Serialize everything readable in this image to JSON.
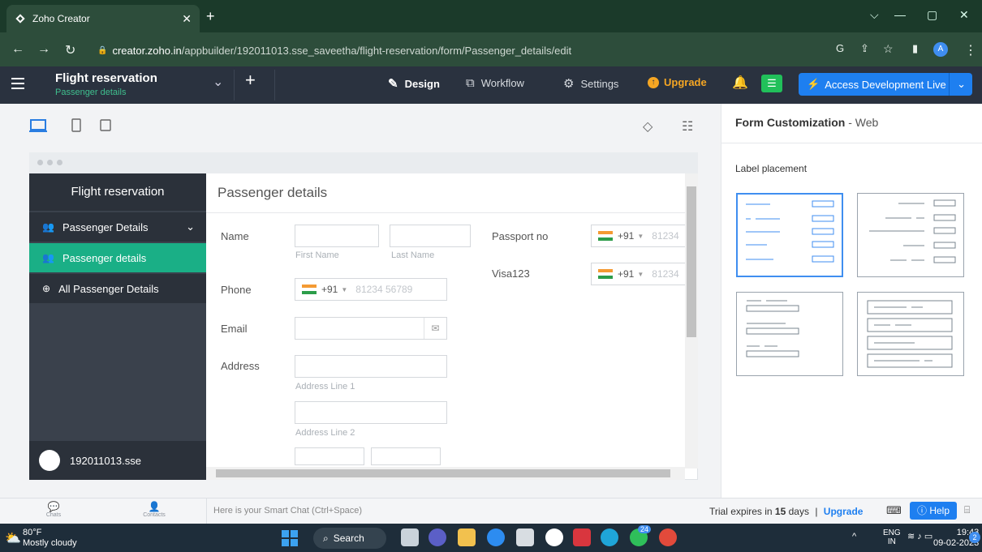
{
  "browser": {
    "tab_title": "Zoho Creator",
    "url_host": "creator.zoho.in",
    "url_path": "/appbuilder/192011013.sse_saveetha/flight-reservation/form/Passenger_details/edit"
  },
  "header": {
    "app_name": "Flight reservation",
    "form_name": "Passenger details",
    "tabs": [
      {
        "label": "Design",
        "icon": "palette-icon"
      },
      {
        "label": "Workflow",
        "icon": "workflow-icon"
      },
      {
        "label": "Settings",
        "icon": "gear-icon"
      }
    ],
    "upgrade_label": "Upgrade",
    "access_label": "Access Development Live"
  },
  "sidebar": {
    "title": "Flight reservation",
    "items": [
      {
        "label": "Passenger Details"
      },
      {
        "label": "Passenger details"
      },
      {
        "label": "All Passenger Details"
      }
    ],
    "user": "192011013.sse"
  },
  "form": {
    "title": "Passenger details",
    "name_label": "Name",
    "first_name_sub": "First Name",
    "last_name_sub": "Last Name",
    "phone_label": "Phone",
    "email_label": "Email",
    "address_label": "Address",
    "address_line1_sub": "Address Line 1",
    "address_line2_sub": "Address Line 2",
    "passport_label": "Passport no",
    "visa_label": "Visa123",
    "country_code": "+91",
    "phone_placeholder": "81234 56789",
    "phone_placeholder_short": "81234"
  },
  "right_panel": {
    "title": "Form Customization",
    "title_suffix": "- Web",
    "label_placement": "Label placement"
  },
  "bottom": {
    "chats": "Chats",
    "contacts": "Contacts",
    "smart_chat": "Here is your Smart Chat (Ctrl+Space)",
    "trial_prefix": "Trial expires in",
    "trial_days": "15",
    "trial_suffix": "days",
    "trial_sep": "|",
    "upgrade": "Upgrade",
    "help": "Help"
  },
  "taskbar": {
    "temp": "80°F",
    "weather": "Mostly cloudy",
    "search": "Search",
    "lang1": "ENG",
    "lang2": "IN",
    "time": "19:43",
    "date": "09-02-2023",
    "notif_count": "2",
    "teams_badge": "24"
  }
}
